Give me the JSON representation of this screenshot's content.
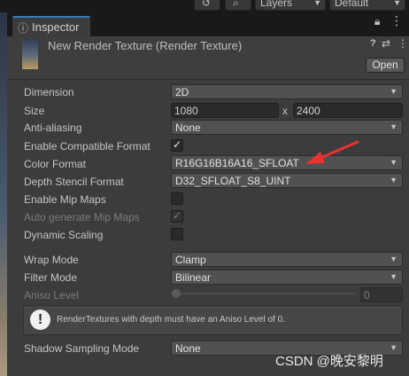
{
  "toolbar": {
    "history_icon": "history-icon",
    "search_icon": "search-icon",
    "layers_label": "Layers",
    "layout_label": "Default"
  },
  "tab": {
    "label": "Inspector",
    "icon": "inspector-icon"
  },
  "asset": {
    "title": "New Render Texture (Render Texture)",
    "open_label": "Open"
  },
  "properties": {
    "dimension": {
      "label": "Dimension",
      "value": "2D"
    },
    "size": {
      "label": "Size",
      "width": "1080",
      "x": "x",
      "height": "2400"
    },
    "anti_aliasing": {
      "label": "Anti-aliasing",
      "value": "None"
    },
    "enable_compatible_format": {
      "label": "Enable Compatible Format",
      "checked": true
    },
    "color_format": {
      "label": "Color Format",
      "value": "R16G16B16A16_SFLOAT"
    },
    "depth_stencil_format": {
      "label": "Depth Stencil Format",
      "value": "D32_SFLOAT_S8_UINT"
    },
    "enable_mip_maps": {
      "label": "Enable Mip Maps",
      "checked": false
    },
    "auto_generate_mip_maps": {
      "label": "Auto generate Mip Maps",
      "checked": true,
      "disabled": true
    },
    "dynamic_scaling": {
      "label": "Dynamic Scaling",
      "checked": false
    },
    "wrap_mode": {
      "label": "Wrap Mode",
      "value": "Clamp"
    },
    "filter_mode": {
      "label": "Filter Mode",
      "value": "Bilinear"
    },
    "aniso_level": {
      "label": "Aniso Level",
      "value": "0",
      "disabled": true
    },
    "shadow_sampling_mode": {
      "label": "Shadow Sampling Mode",
      "value": "None"
    }
  },
  "helpbox": {
    "text": "RenderTextures with depth must have an Aniso Level of 0."
  },
  "watermark": "CSDN @晚安黎明",
  "colors": {
    "panel_bg": "#3c3c3c",
    "field_bg": "#515151",
    "annotation_red": "#e8322e",
    "tab_accent": "#3a79bb"
  }
}
